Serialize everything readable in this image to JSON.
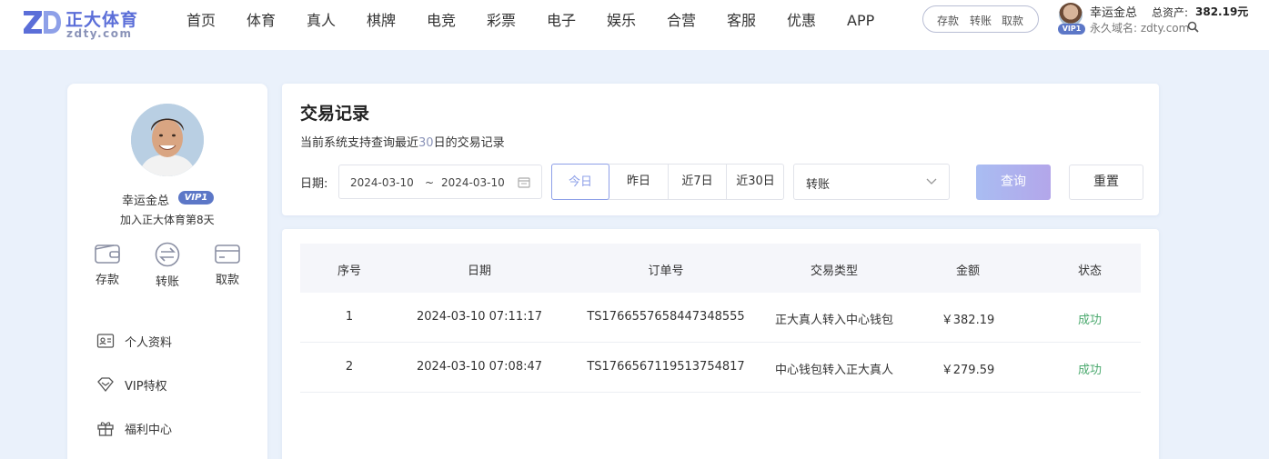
{
  "brand": {
    "name_cn": "正大体育",
    "domain": "zdty.com",
    "mark": "ZD"
  },
  "nav": [
    "首页",
    "体育",
    "真人",
    "棋牌",
    "电竞",
    "彩票",
    "电子",
    "娱乐",
    "合营",
    "客服",
    "优惠",
    "APP"
  ],
  "quick_actions": [
    "存款",
    "转账",
    "取款"
  ],
  "account": {
    "username": "幸运金总",
    "vip": "VIP1",
    "total_assets_label": "总资产:",
    "total_assets_value": "382.19元",
    "permanent_domain_label": "永久域名:",
    "permanent_domain_value": "zdty.com"
  },
  "sidebar": {
    "username": "幸运金总",
    "vip": "VIP1",
    "join_text": "加入正大体育第8天",
    "actions": [
      {
        "label": "存款",
        "icon": "wallet-icon"
      },
      {
        "label": "转账",
        "icon": "transfer-icon"
      },
      {
        "label": "取款",
        "icon": "card-icon"
      }
    ],
    "menu": [
      {
        "label": "个人资料",
        "icon": "id-card-icon"
      },
      {
        "label": "VIP特权",
        "icon": "diamond-icon"
      },
      {
        "label": "福利中心",
        "icon": "gift-icon"
      }
    ]
  },
  "filter": {
    "title": "交易记录",
    "subtitle_prefix": "当前系统支持查询最近",
    "subtitle_days": "30",
    "subtitle_suffix": "日的交易记录",
    "date_label": "日期:",
    "date_start": "2024-03-10",
    "date_sep": "~",
    "date_end": "2024-03-10",
    "ranges": [
      "今日",
      "昨日",
      "近7日",
      "近30日"
    ],
    "active_range": "今日",
    "type_value": "转账",
    "query_label": "查询",
    "reset_label": "重置"
  },
  "table": {
    "columns": [
      "序号",
      "日期",
      "订单号",
      "交易类型",
      "金额",
      "状态"
    ],
    "rows": [
      [
        "1",
        "2024-03-10 07:11:17",
        "TS1766557658447348555",
        "正大真人转入中心钱包",
        "￥382.19",
        "成功"
      ],
      [
        "2",
        "2024-03-10 07:08:47",
        "TS1766567119513754817",
        "中心钱包转入正大真人",
        "￥279.59",
        "成功"
      ]
    ]
  },
  "colors": {
    "accent": "#5b6ed8",
    "vip_badge": "#5c77c7",
    "success": "#4caa6f",
    "page_bg": "#eaf1fb"
  }
}
